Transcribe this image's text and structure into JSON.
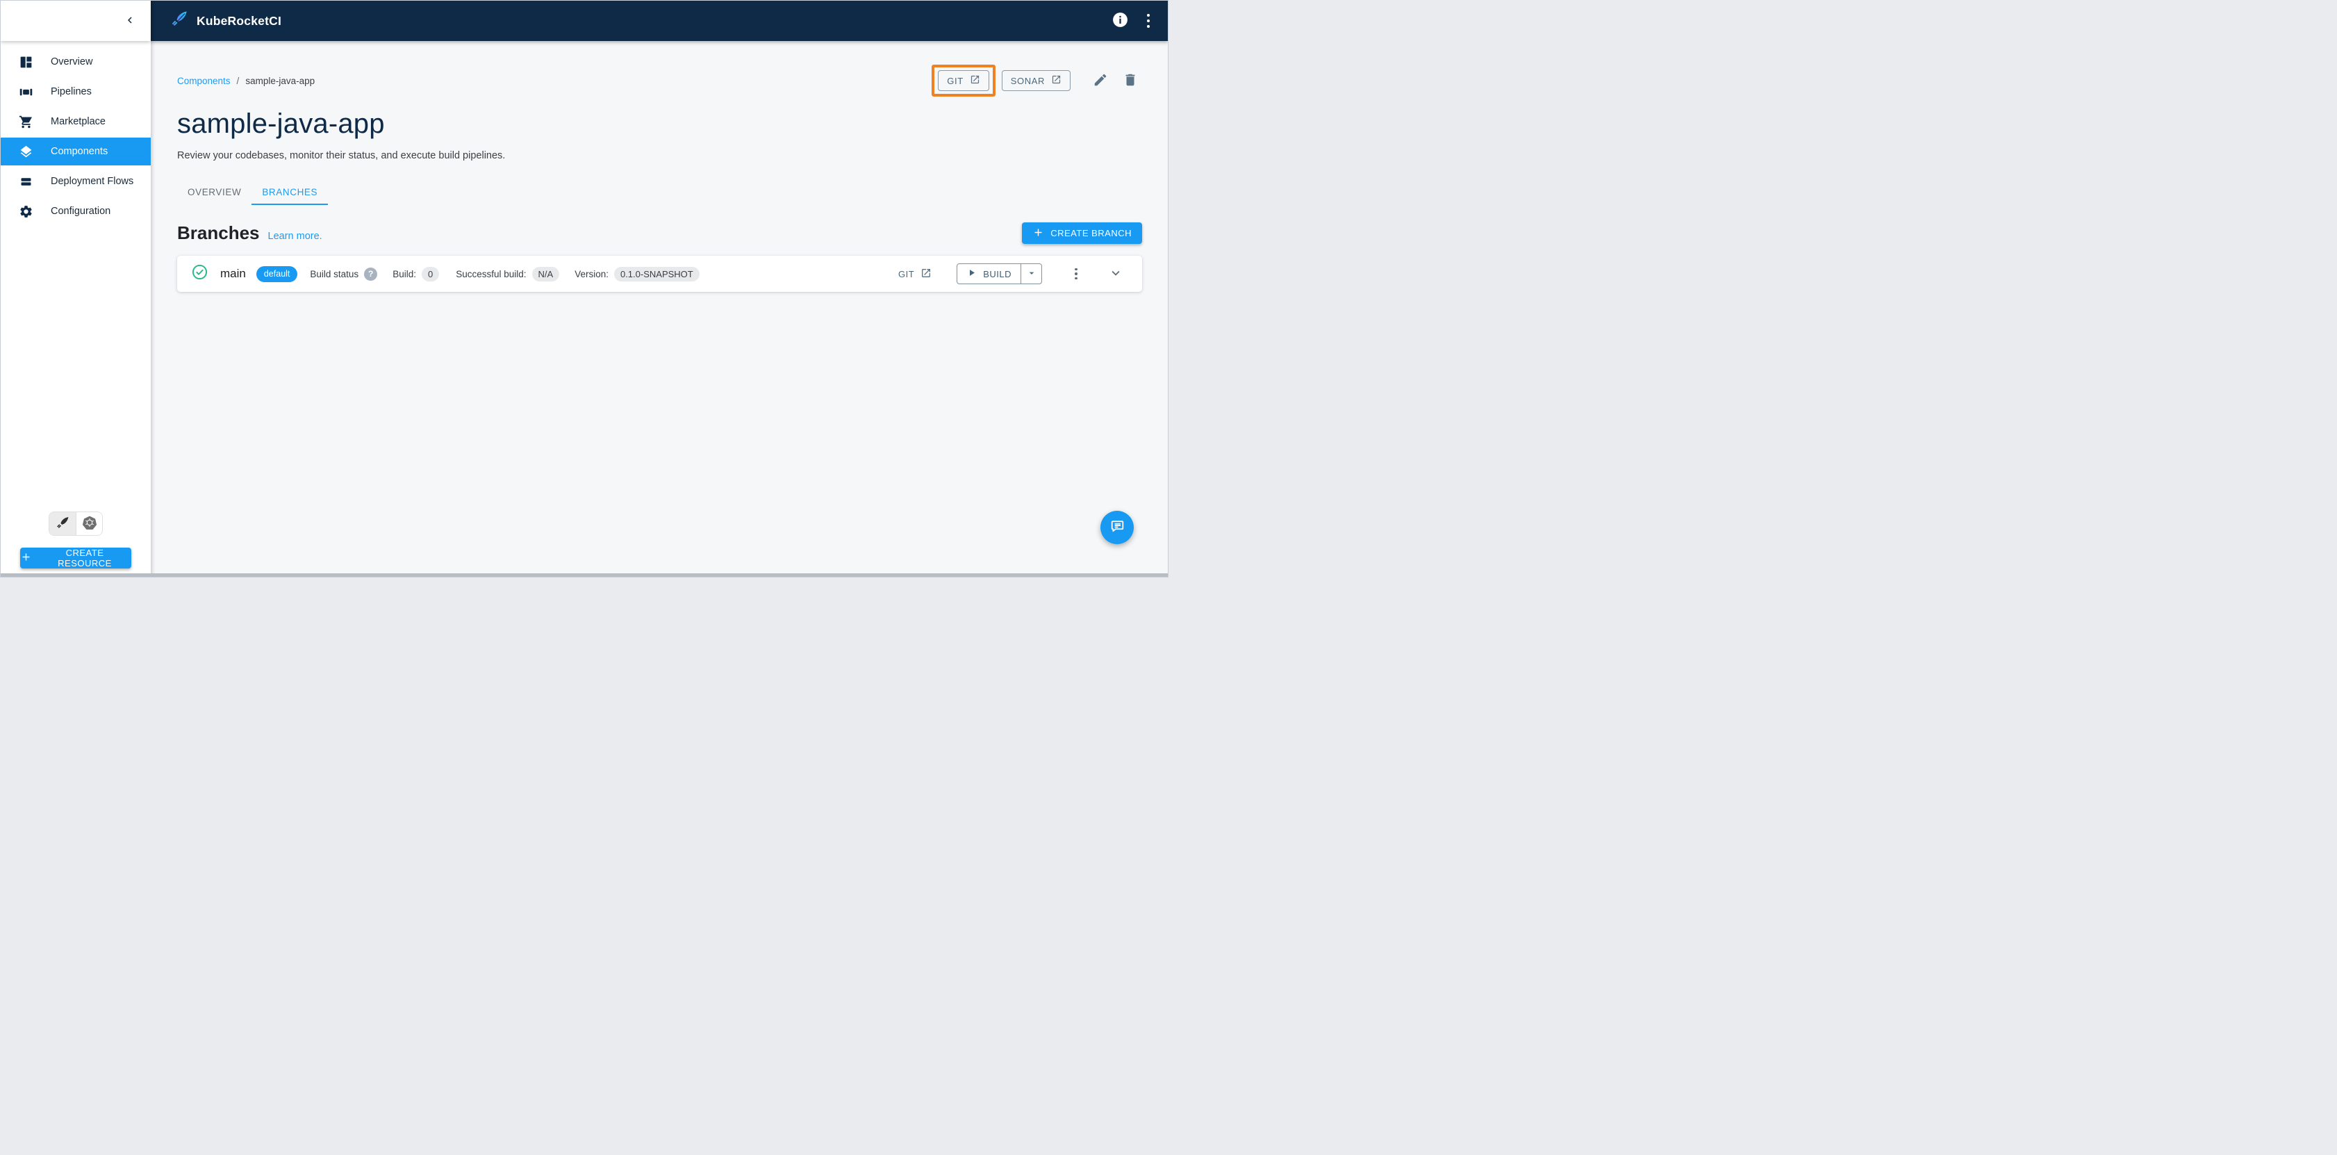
{
  "header": {
    "app_name": "KubeRocketCI"
  },
  "sidebar": {
    "items": [
      {
        "label": "Overview",
        "icon": "dashboard-icon",
        "selected": false
      },
      {
        "label": "Pipelines",
        "icon": "pipelines-icon",
        "selected": false
      },
      {
        "label": "Marketplace",
        "icon": "cart-icon",
        "selected": false
      },
      {
        "label": "Components",
        "icon": "layers-icon",
        "selected": true
      },
      {
        "label": "Deployment Flows",
        "icon": "flows-icon",
        "selected": false
      },
      {
        "label": "Configuration",
        "icon": "gear-icon",
        "selected": false
      }
    ],
    "cluster_toggle": {
      "options": [
        "kuberocketci-logo-icon",
        "kubernetes-icon"
      ],
      "selected": "kuberocketci-logo-icon"
    },
    "create_resource_label": "CREATE RESOURCE"
  },
  "breadcrumb": {
    "root": "Components",
    "separator": "/",
    "current": "sample-java-app"
  },
  "page": {
    "title": "sample-java-app",
    "description": "Review your codebases, monitor their status, and execute build pipelines.",
    "actions": {
      "git_label": "GIT",
      "sonar_label": "SONAR"
    }
  },
  "tabs": [
    {
      "label": "OVERVIEW",
      "active": false
    },
    {
      "label": "BRANCHES",
      "active": true
    }
  ],
  "branches_section": {
    "heading": "Branches",
    "learn_more_label": "Learn more.",
    "create_branch_label": "CREATE BRANCH"
  },
  "branch_row": {
    "name": "main",
    "default_badge": "default",
    "build_status_label": "Build status",
    "build_status_help": "?",
    "build_label": "Build:",
    "build_value": "0",
    "successful_build_label": "Successful build:",
    "successful_build_value": "N/A",
    "version_label": "Version:",
    "version_value": "0.1.0-SNAPSHOT",
    "git_label": "GIT",
    "build_button_label": "BUILD"
  },
  "colors": {
    "header_navy": "#0e2a47",
    "accent_blue": "#1899f2",
    "link_blue": "#1e9bf0",
    "highlight_orange": "#ef8225",
    "success_green": "#2eb88a",
    "content_background": "#f6f7f9"
  }
}
